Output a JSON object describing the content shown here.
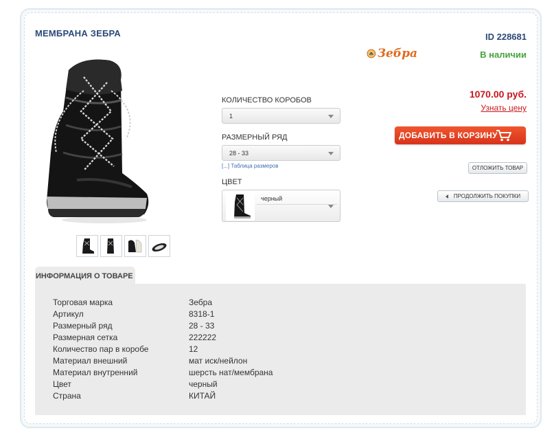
{
  "product": {
    "title": "МЕМБРАНА ЗЕБРА",
    "id_label": "ID 228681",
    "stock_status": "В наличии",
    "brand_logo_text": "Зебра",
    "price": "1070.00 руб.",
    "ask_price_link": "Узнать цену"
  },
  "options": {
    "boxes_label": "КОЛИЧЕСТВО КОРОБОВ",
    "boxes_value": "1",
    "size_label": "РАЗМЕРНЫЙ РЯД",
    "size_value": "28 - 33",
    "size_table_link": "[...] Таблица размеров",
    "color_label": "ЦВЕТ",
    "color_value": "черный"
  },
  "actions": {
    "add_to_cart": "ДОБАВИТЬ В КОРЗИНУ",
    "postpone": "ОТЛОЖИТЬ ТОВАР",
    "continue_shopping": "ПРОДОЛЖИТЬ ПОКУПКИ"
  },
  "info": {
    "tab_label": "ИНФОРМАЦИЯ О ТОВАРЕ",
    "specs": [
      {
        "key": "Торговая марка",
        "value": "Зебра"
      },
      {
        "key": "Артикул",
        "value": "8318-1"
      },
      {
        "key": "Размерный ряд",
        "value": "28 - 33"
      },
      {
        "key": "Размерная сетка",
        "value": "222222"
      },
      {
        "key": "Количество пар в коробе",
        "value": "12"
      },
      {
        "key": "Материал внешний",
        "value": "мат иск/нейлон"
      },
      {
        "key": "Материал внутренний",
        "value": "шерсть нат/мембрана"
      },
      {
        "key": "Цвет",
        "value": "черный"
      },
      {
        "key": "Страна",
        "value": "КИТАЙ"
      }
    ]
  },
  "colors": {
    "title": "#2b4a78",
    "in_stock": "#47a23d",
    "price": "#c8171e",
    "cart_button": "#e2401f",
    "panel_bg": "#ebebeb"
  },
  "icons": {
    "cart": "shopping-cart-icon",
    "brand": "zebra-logo-icon",
    "back": "triangle-left-icon",
    "dropdown": "chevron-down-icon"
  }
}
